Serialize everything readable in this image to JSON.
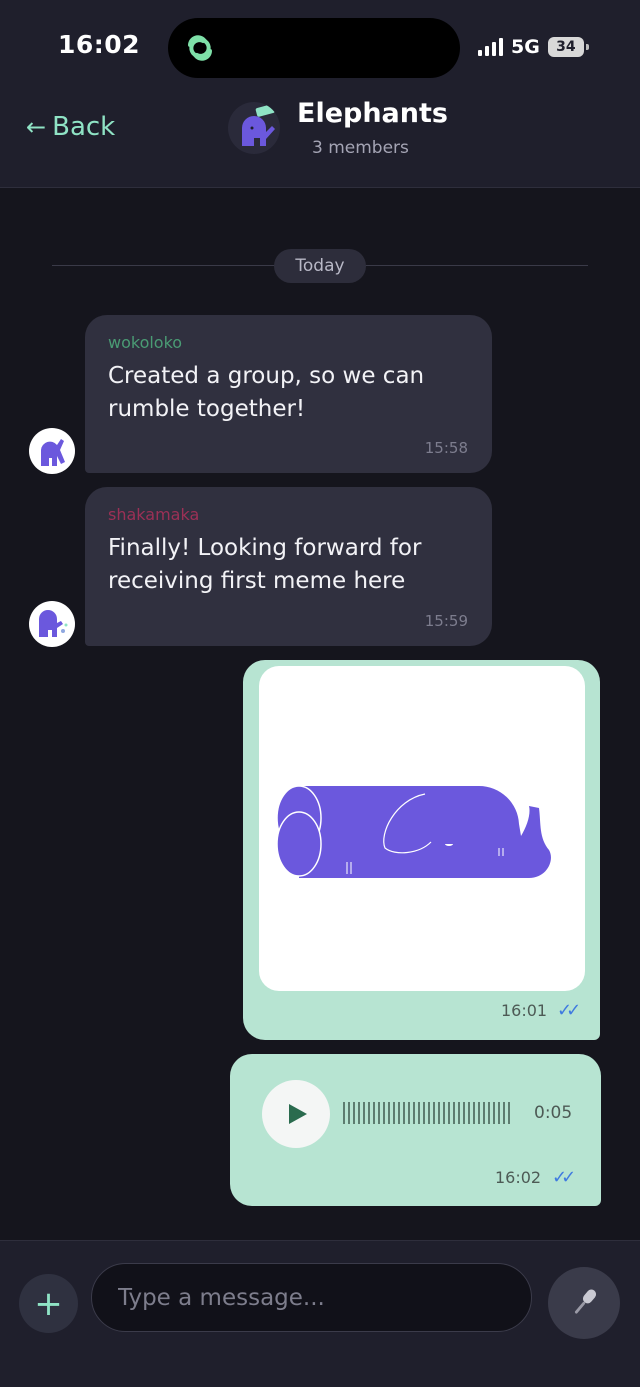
{
  "status_bar": {
    "time": "16:02",
    "network": "5G",
    "battery": "34",
    "icons": [
      "app-link-icon",
      "signal-icon",
      "battery-icon"
    ]
  },
  "header": {
    "back_label": "Back",
    "title": "Elephants",
    "subtitle": "3 members"
  },
  "date_separator": "Today",
  "messages": [
    {
      "sender": "wokoloko",
      "sender_color": "#4a9b74",
      "text": "Created a group, so we can rumble together!",
      "time": "15:58"
    },
    {
      "sender": "shakamaka",
      "sender_color": "#9c3056",
      "text": "Finally! Looking forward for receiving first meme here",
      "time": "15:59"
    }
  ],
  "outgoing_image": {
    "time": "16:01",
    "status": "read"
  },
  "outgoing_voice": {
    "duration": "0:05",
    "time": "16:02",
    "status": "read"
  },
  "composer": {
    "placeholder": "Type a message..."
  },
  "colors": {
    "accent": "#8fe3c5",
    "outgoing_bubble": "#b7e4d2",
    "incoming_bubble": "#30303f",
    "elephant": "#6b58dd",
    "read_ticks": "#3f7ae0"
  }
}
